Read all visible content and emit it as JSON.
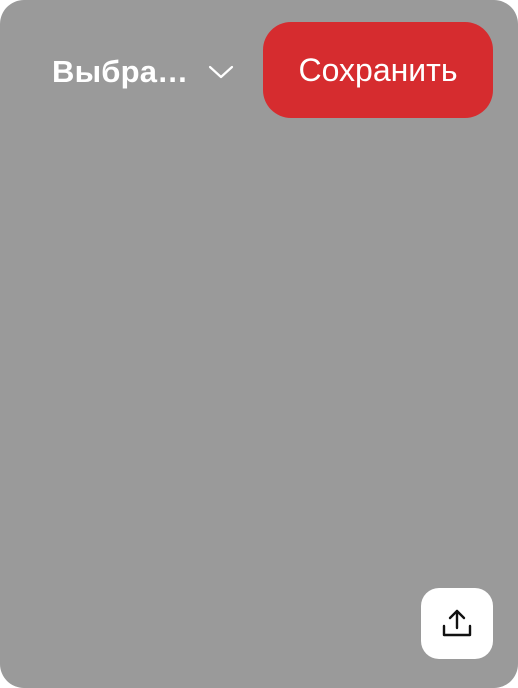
{
  "board_selector": {
    "label": "Выбра…",
    "icon": "chevron-down-icon"
  },
  "save_button": {
    "label": "Сохранить",
    "color": "#d62c2f"
  },
  "share_button": {
    "icon": "share-upload-icon"
  },
  "colors": {
    "card_background": "#9a9a9a",
    "text_on_card": "#ffffff"
  }
}
